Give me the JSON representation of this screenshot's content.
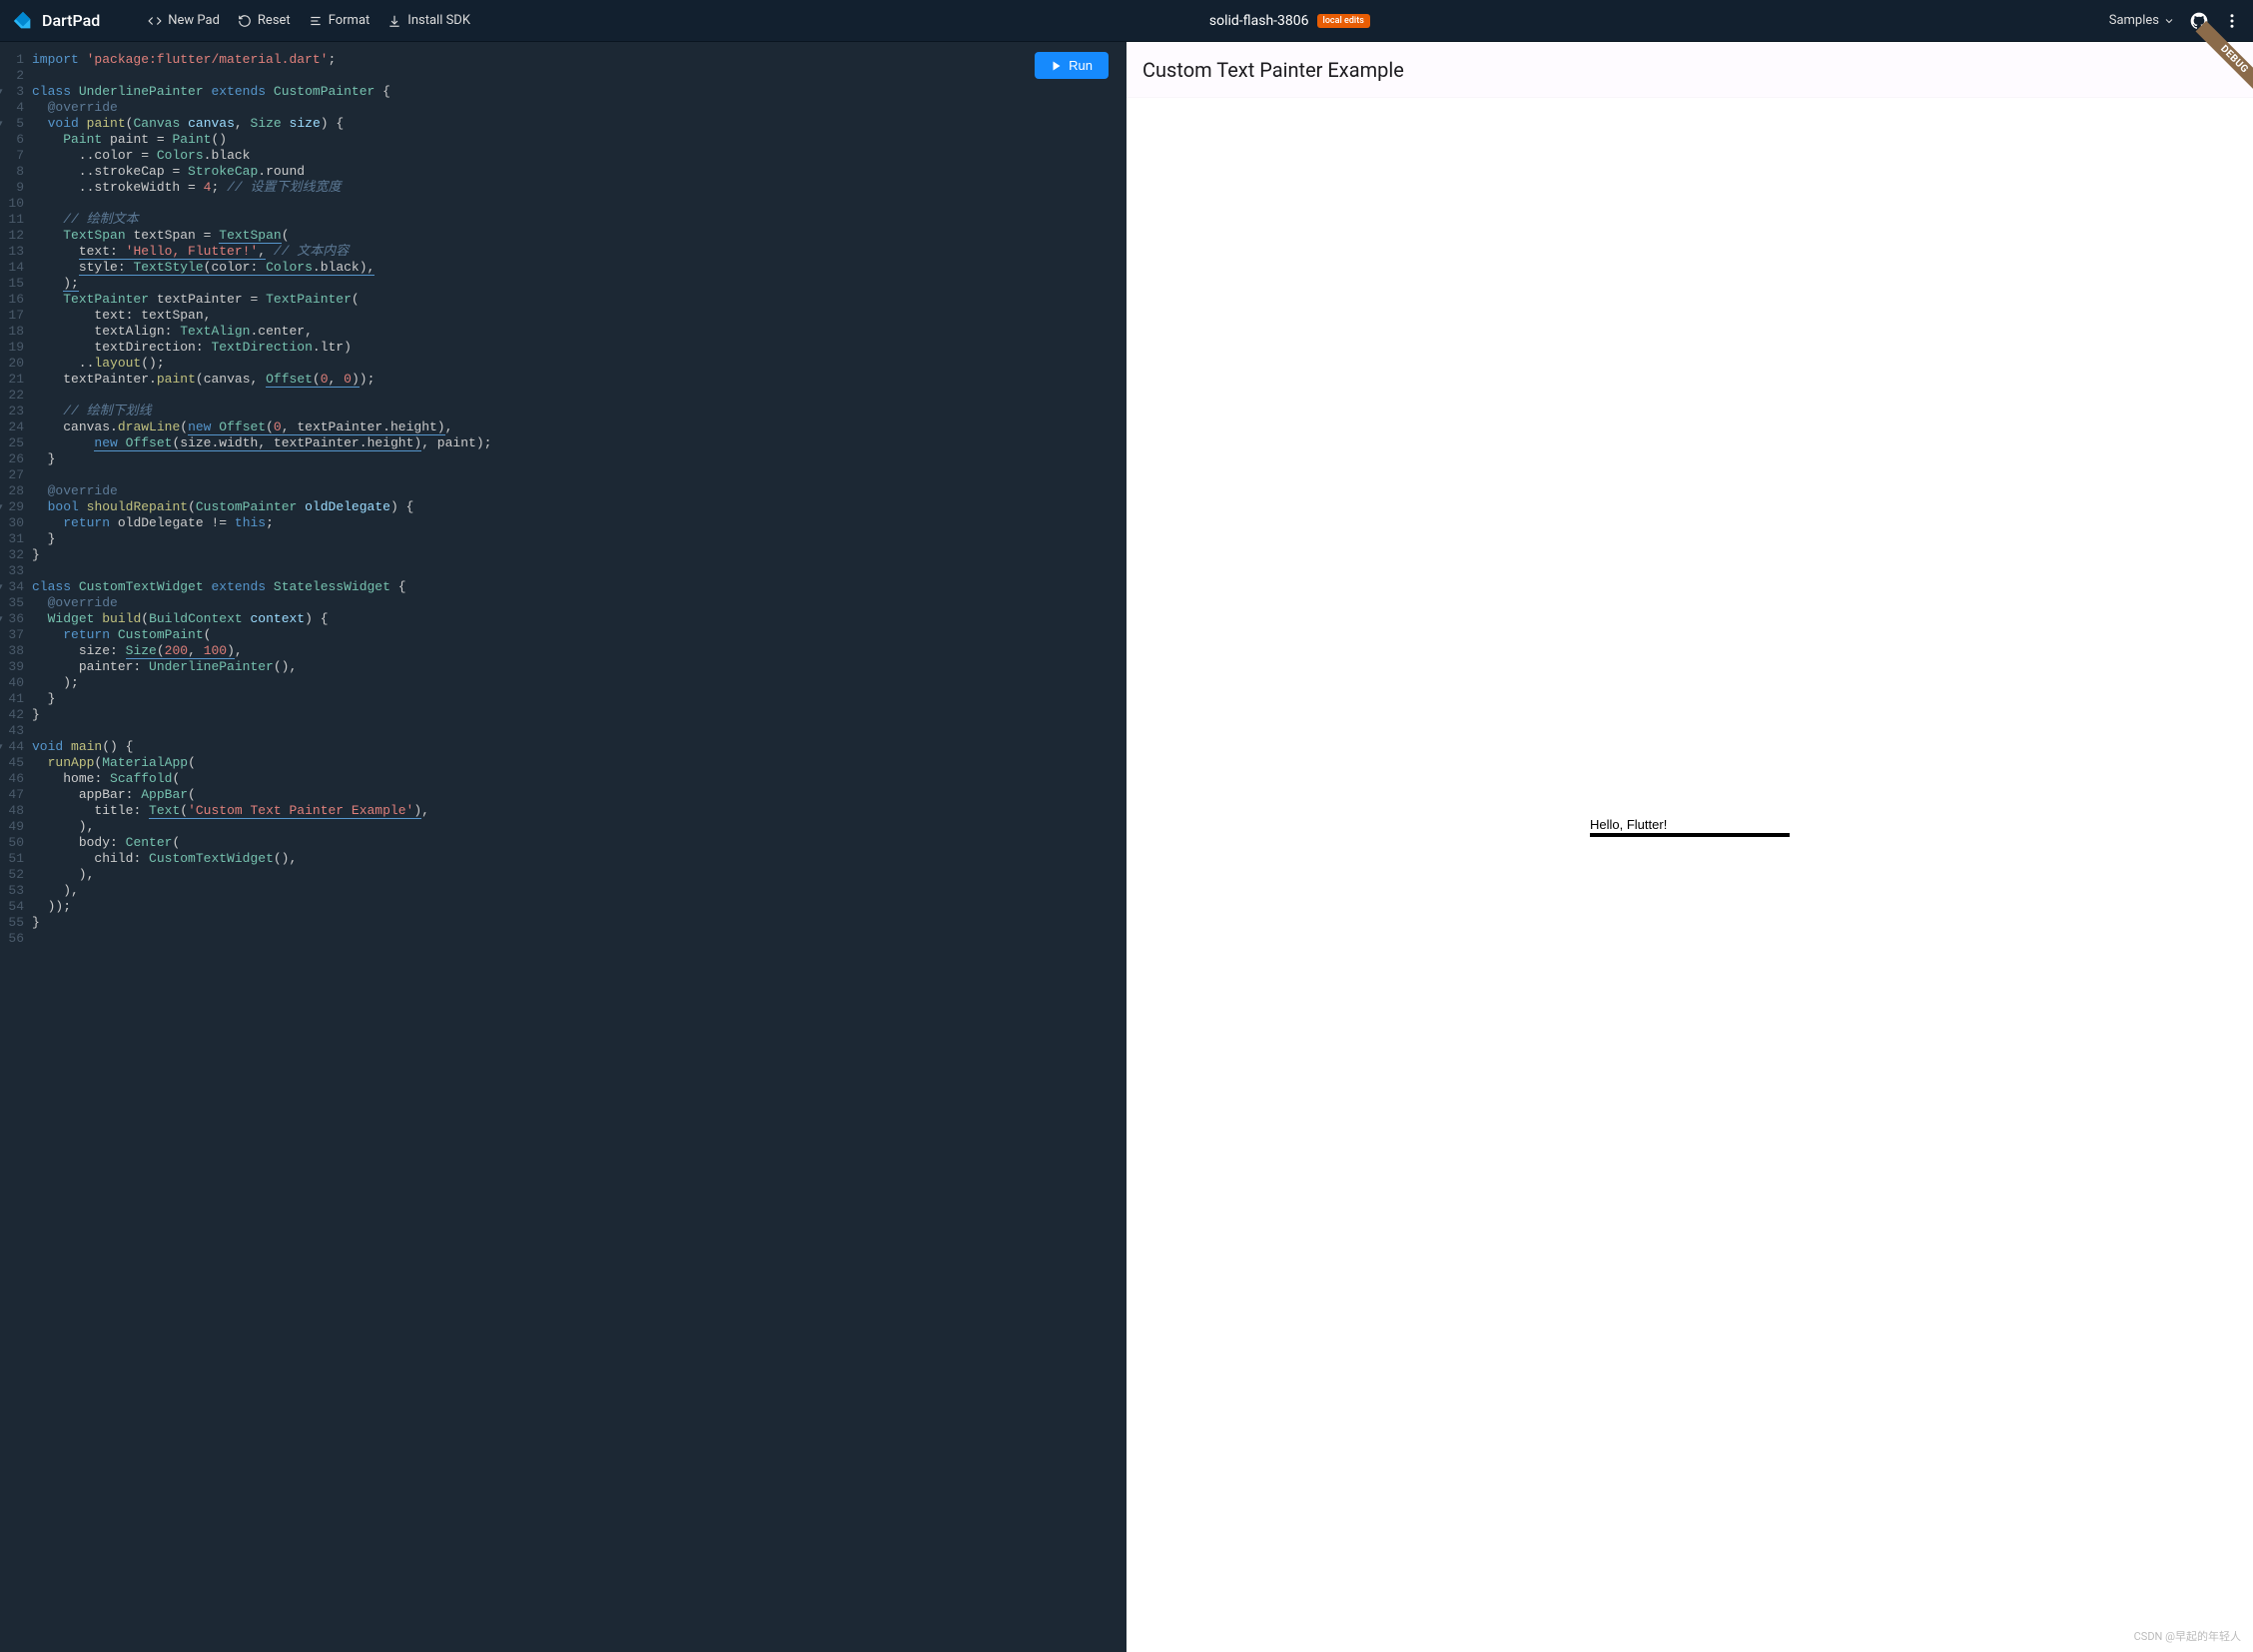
{
  "header": {
    "brand": "DartPad",
    "toolbar": {
      "newpad": "New Pad",
      "reset": "Reset",
      "format": "Format",
      "install": "Install SDK"
    },
    "project_name": "solid-flash-3806",
    "badge": "local edits",
    "samples": "Samples"
  },
  "run_button": "Run",
  "preview": {
    "app_title": "Custom Text Painter Example",
    "painted_text": "Hello, Flutter!",
    "debug": "DEBUG"
  },
  "watermark": "CSDN @早起的年轻人",
  "code": {
    "line_count": 56,
    "folds": [
      3,
      5,
      29,
      34,
      36,
      44
    ],
    "lines": [
      [
        [
          "kw",
          "import"
        ],
        [
          "punct",
          " "
        ],
        [
          "str",
          "'package:flutter/material.dart'"
        ],
        [
          "punct",
          ";"
        ]
      ],
      [],
      [
        [
          "kw",
          "class"
        ],
        [
          "punct",
          " "
        ],
        [
          "type",
          "UnderlinePainter"
        ],
        [
          "punct",
          " "
        ],
        [
          "kw",
          "extends"
        ],
        [
          "punct",
          " "
        ],
        [
          "type",
          "CustomPainter"
        ],
        [
          "punct",
          " {"
        ]
      ],
      [
        [
          "punct",
          "  "
        ],
        [
          "anno",
          "@override"
        ]
      ],
      [
        [
          "punct",
          "  "
        ],
        [
          "kw",
          "void"
        ],
        [
          "punct",
          " "
        ],
        [
          "func",
          "paint"
        ],
        [
          "punct",
          "("
        ],
        [
          "type",
          "Canvas"
        ],
        [
          "punct",
          " "
        ],
        [
          "param",
          "canvas"
        ],
        [
          "punct",
          ", "
        ],
        [
          "type",
          "Size"
        ],
        [
          "punct",
          " "
        ],
        [
          "param",
          "size"
        ],
        [
          "punct",
          ") {"
        ]
      ],
      [
        [
          "punct",
          "    "
        ],
        [
          "type",
          "Paint"
        ],
        [
          "punct",
          " "
        ],
        [
          "ident",
          "paint"
        ],
        [
          "punct",
          " = "
        ],
        [
          "type",
          "Paint"
        ],
        [
          "punct",
          "()"
        ]
      ],
      [
        [
          "punct",
          "      .."
        ],
        [
          "prop",
          "color"
        ],
        [
          "punct",
          " = "
        ],
        [
          "type",
          "Colors"
        ],
        [
          "punct",
          "."
        ],
        [
          "prop",
          "black"
        ]
      ],
      [
        [
          "punct",
          "      .."
        ],
        [
          "prop",
          "strokeCap"
        ],
        [
          "punct",
          " = "
        ],
        [
          "type",
          "StrokeCap"
        ],
        [
          "punct",
          "."
        ],
        [
          "prop",
          "round"
        ]
      ],
      [
        [
          "punct",
          "      .."
        ],
        [
          "prop",
          "strokeWidth"
        ],
        [
          "punct",
          " = "
        ],
        [
          "num",
          "4"
        ],
        [
          "punct",
          "; "
        ],
        [
          "comment",
          "// 设置下划线宽度"
        ]
      ],
      [],
      [
        [
          "punct",
          "    "
        ],
        [
          "comment",
          "// 绘制文本"
        ]
      ],
      [
        [
          "punct",
          "    "
        ],
        [
          "type",
          "TextSpan"
        ],
        [
          "punct",
          " "
        ],
        [
          "ident",
          "textSpan"
        ],
        [
          "punct",
          " = "
        ],
        [
          "type underline-err",
          "TextSpan"
        ],
        [
          "punct",
          "("
        ]
      ],
      [
        [
          "punct",
          "      "
        ],
        [
          "prop underline-err",
          "text"
        ],
        [
          "punct underline-err",
          ": "
        ],
        [
          "str underline-err",
          "'Hello, Flutter!'"
        ],
        [
          "punct underline-err",
          ","
        ],
        [
          "punct",
          " "
        ],
        [
          "comment",
          "// 文本内容"
        ]
      ],
      [
        [
          "punct",
          "      "
        ],
        [
          "prop underline-err",
          "style"
        ],
        [
          "punct underline-err",
          ": "
        ],
        [
          "type underline-err",
          "TextStyle"
        ],
        [
          "punct underline-err",
          "("
        ],
        [
          "prop underline-err",
          "color"
        ],
        [
          "punct underline-err",
          ": "
        ],
        [
          "type underline-err",
          "Colors"
        ],
        [
          "punct underline-err",
          "."
        ],
        [
          "prop underline-err",
          "black"
        ],
        [
          "punct underline-err",
          "),"
        ]
      ],
      [
        [
          "punct",
          "    "
        ],
        [
          "punct underline-err",
          ");"
        ]
      ],
      [
        [
          "punct",
          "    "
        ],
        [
          "type",
          "TextPainter"
        ],
        [
          "punct",
          " "
        ],
        [
          "ident",
          "textPainter"
        ],
        [
          "punct",
          " = "
        ],
        [
          "type",
          "TextPainter"
        ],
        [
          "punct",
          "("
        ]
      ],
      [
        [
          "punct",
          "        "
        ],
        [
          "prop",
          "text"
        ],
        [
          "punct",
          ": "
        ],
        [
          "ident",
          "textSpan"
        ],
        [
          "punct",
          ","
        ]
      ],
      [
        [
          "punct",
          "        "
        ],
        [
          "prop",
          "textAlign"
        ],
        [
          "punct",
          ": "
        ],
        [
          "type",
          "TextAlign"
        ],
        [
          "punct",
          "."
        ],
        [
          "prop",
          "center"
        ],
        [
          "punct",
          ","
        ]
      ],
      [
        [
          "punct",
          "        "
        ],
        [
          "prop",
          "textDirection"
        ],
        [
          "punct",
          ": "
        ],
        [
          "type",
          "TextDirection"
        ],
        [
          "punct",
          "."
        ],
        [
          "prop",
          "ltr"
        ],
        [
          "punct",
          ")"
        ]
      ],
      [
        [
          "punct",
          "      .."
        ],
        [
          "func",
          "layout"
        ],
        [
          "punct",
          "();"
        ]
      ],
      [
        [
          "punct",
          "    "
        ],
        [
          "ident",
          "textPainter"
        ],
        [
          "punct",
          "."
        ],
        [
          "func",
          "paint"
        ],
        [
          "punct",
          "("
        ],
        [
          "ident",
          "canvas"
        ],
        [
          "punct",
          ", "
        ],
        [
          "type underline-err",
          "Offset"
        ],
        [
          "punct underline-err",
          "("
        ],
        [
          "num underline-err",
          "0"
        ],
        [
          "punct underline-err",
          ", "
        ],
        [
          "num underline-err",
          "0"
        ],
        [
          "punct underline-err",
          ")"
        ],
        [
          "punct",
          ");"
        ]
      ],
      [],
      [
        [
          "punct",
          "    "
        ],
        [
          "comment",
          "// 绘制下划线"
        ]
      ],
      [
        [
          "punct",
          "    "
        ],
        [
          "ident",
          "canvas"
        ],
        [
          "punct",
          "."
        ],
        [
          "func",
          "drawLine"
        ],
        [
          "punct",
          "("
        ],
        [
          "kw underline-err",
          "new"
        ],
        [
          "punct underline-err",
          " "
        ],
        [
          "type underline-err",
          "Offset"
        ],
        [
          "punct underline-err",
          "("
        ],
        [
          "num underline-err",
          "0"
        ],
        [
          "punct underline-err",
          ", "
        ],
        [
          "ident underline-err",
          "textPainter"
        ],
        [
          "punct underline-err",
          "."
        ],
        [
          "prop underline-err",
          "height"
        ],
        [
          "punct underline-err",
          ")"
        ],
        [
          "punct",
          ","
        ]
      ],
      [
        [
          "punct",
          "        "
        ],
        [
          "kw underline-err",
          "new"
        ],
        [
          "punct underline-err",
          " "
        ],
        [
          "type underline-err",
          "Offset"
        ],
        [
          "punct underline-err",
          "("
        ],
        [
          "ident underline-err",
          "size"
        ],
        [
          "punct underline-err",
          "."
        ],
        [
          "prop underline-err",
          "width"
        ],
        [
          "punct underline-err",
          ", "
        ],
        [
          "ident underline-err",
          "textPainter"
        ],
        [
          "punct underline-err",
          "."
        ],
        [
          "prop underline-err",
          "height"
        ],
        [
          "punct underline-err",
          ")"
        ],
        [
          "punct",
          ", "
        ],
        [
          "ident",
          "paint"
        ],
        [
          "punct",
          ");"
        ]
      ],
      [
        [
          "punct",
          "  }"
        ]
      ],
      [],
      [
        [
          "punct",
          "  "
        ],
        [
          "anno",
          "@override"
        ]
      ],
      [
        [
          "punct",
          "  "
        ],
        [
          "kw",
          "bool"
        ],
        [
          "punct",
          " "
        ],
        [
          "func",
          "shouldRepaint"
        ],
        [
          "punct",
          "("
        ],
        [
          "type",
          "CustomPainter"
        ],
        [
          "punct",
          " "
        ],
        [
          "param",
          "oldDelegate"
        ],
        [
          "punct",
          ") {"
        ]
      ],
      [
        [
          "punct",
          "    "
        ],
        [
          "kw",
          "return"
        ],
        [
          "punct",
          " "
        ],
        [
          "ident",
          "oldDelegate"
        ],
        [
          "punct",
          " != "
        ],
        [
          "kw",
          "this"
        ],
        [
          "punct",
          ";"
        ]
      ],
      [
        [
          "punct",
          "  }"
        ]
      ],
      [
        [
          "punct",
          "}"
        ]
      ],
      [],
      [
        [
          "kw",
          "class"
        ],
        [
          "punct",
          " "
        ],
        [
          "type",
          "CustomTextWidget"
        ],
        [
          "punct",
          " "
        ],
        [
          "kw",
          "extends"
        ],
        [
          "punct",
          " "
        ],
        [
          "type",
          "StatelessWidget"
        ],
        [
          "punct",
          " {"
        ]
      ],
      [
        [
          "punct",
          "  "
        ],
        [
          "anno",
          "@override"
        ]
      ],
      [
        [
          "punct",
          "  "
        ],
        [
          "type",
          "Widget"
        ],
        [
          "punct",
          " "
        ],
        [
          "func",
          "build"
        ],
        [
          "punct",
          "("
        ],
        [
          "type",
          "BuildContext"
        ],
        [
          "punct",
          " "
        ],
        [
          "param",
          "context"
        ],
        [
          "punct",
          ") {"
        ]
      ],
      [
        [
          "punct",
          "    "
        ],
        [
          "kw",
          "return"
        ],
        [
          "punct",
          " "
        ],
        [
          "type",
          "CustomPaint"
        ],
        [
          "punct",
          "("
        ]
      ],
      [
        [
          "punct",
          "      "
        ],
        [
          "prop",
          "size"
        ],
        [
          "punct",
          ": "
        ],
        [
          "type underline-err",
          "Size"
        ],
        [
          "punct underline-err",
          "("
        ],
        [
          "num underline-err",
          "200"
        ],
        [
          "punct underline-err",
          ", "
        ],
        [
          "num underline-err",
          "100"
        ],
        [
          "punct underline-err",
          ")"
        ],
        [
          "punct",
          ","
        ]
      ],
      [
        [
          "punct",
          "      "
        ],
        [
          "prop",
          "painter"
        ],
        [
          "punct",
          ": "
        ],
        [
          "type",
          "UnderlinePainter"
        ],
        [
          "punct",
          "(),"
        ]
      ],
      [
        [
          "punct",
          "    );"
        ]
      ],
      [
        [
          "punct",
          "  }"
        ]
      ],
      [
        [
          "punct",
          "}"
        ]
      ],
      [],
      [
        [
          "kw",
          "void"
        ],
        [
          "punct",
          " "
        ],
        [
          "func",
          "main"
        ],
        [
          "punct",
          "() {"
        ]
      ],
      [
        [
          "punct",
          "  "
        ],
        [
          "func",
          "runApp"
        ],
        [
          "punct",
          "("
        ],
        [
          "type",
          "MaterialApp"
        ],
        [
          "punct",
          "("
        ]
      ],
      [
        [
          "punct",
          "    "
        ],
        [
          "prop",
          "home"
        ],
        [
          "punct",
          ": "
        ],
        [
          "type",
          "Scaffold"
        ],
        [
          "punct",
          "("
        ]
      ],
      [
        [
          "punct",
          "      "
        ],
        [
          "prop",
          "appBar"
        ],
        [
          "punct",
          ": "
        ],
        [
          "type",
          "AppBar"
        ],
        [
          "punct",
          "("
        ]
      ],
      [
        [
          "punct",
          "        "
        ],
        [
          "prop",
          "title"
        ],
        [
          "punct",
          ": "
        ],
        [
          "type underline-err",
          "Text"
        ],
        [
          "punct underline-err",
          "("
        ],
        [
          "str underline-err",
          "'Custom Text Painter Example'"
        ],
        [
          "punct underline-err",
          ")"
        ],
        [
          "punct",
          ","
        ]
      ],
      [
        [
          "punct",
          "      ),"
        ]
      ],
      [
        [
          "punct",
          "      "
        ],
        [
          "prop",
          "body"
        ],
        [
          "punct",
          ": "
        ],
        [
          "type",
          "Center"
        ],
        [
          "punct",
          "("
        ]
      ],
      [
        [
          "punct",
          "        "
        ],
        [
          "prop",
          "child"
        ],
        [
          "punct",
          ": "
        ],
        [
          "type",
          "CustomTextWidget"
        ],
        [
          "punct",
          "(),"
        ]
      ],
      [
        [
          "punct",
          "      ),"
        ]
      ],
      [
        [
          "punct",
          "    ),"
        ]
      ],
      [
        [
          "punct",
          "  ));"
        ]
      ],
      [
        [
          "punct",
          "}"
        ]
      ],
      []
    ]
  }
}
